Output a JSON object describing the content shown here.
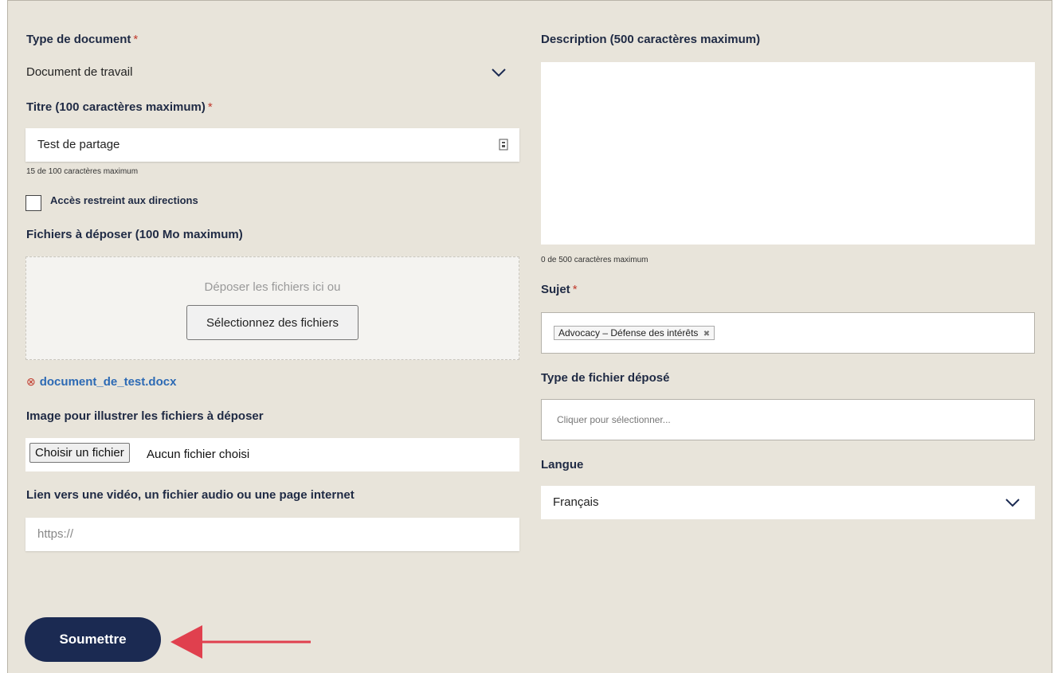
{
  "left": {
    "doc_type": {
      "label": "Type de document",
      "required_mark": "*",
      "value": "Document de travail"
    },
    "title": {
      "label": "Titre (100 caractères maximum)",
      "required_mark": "*",
      "value": "Test de partage",
      "counter": "15 de 100 caractères maximum"
    },
    "restricted": {
      "label": "Accès restreint aux directions",
      "checked": false
    },
    "files": {
      "label": "Fichiers à déposer (100 Mo maximum)",
      "drop_text": "Déposer les fichiers ici ou",
      "select_button": "Sélectionnez des fichiers",
      "uploaded_file": "document_de_test.docx"
    },
    "image": {
      "label": "Image pour illustrer les fichiers à déposer",
      "button": "Choisir un fichier",
      "status": "Aucun fichier choisi"
    },
    "link": {
      "label": "Lien vers une vidéo, un fichier audio ou une page internet",
      "placeholder": "https://"
    },
    "submit_label": "Soumettre"
  },
  "right": {
    "description": {
      "label": "Description (500 caractères maximum)",
      "counter": "0 de 500 caractères maximum"
    },
    "subject": {
      "label": "Sujet",
      "required_mark": "*",
      "tag": "Advocacy – Défense des intérêts",
      "tag_remove": "✖"
    },
    "file_type": {
      "label": "Type de fichier déposé",
      "placeholder": "Cliquer pour sélectionner..."
    },
    "language": {
      "label": "Langue",
      "value": "Français"
    }
  },
  "colors": {
    "accent": "#1b2a52",
    "required": "#c0392b",
    "link": "#2d6ab4",
    "arrow": "#e0404e",
    "background": "#e8e4da"
  }
}
